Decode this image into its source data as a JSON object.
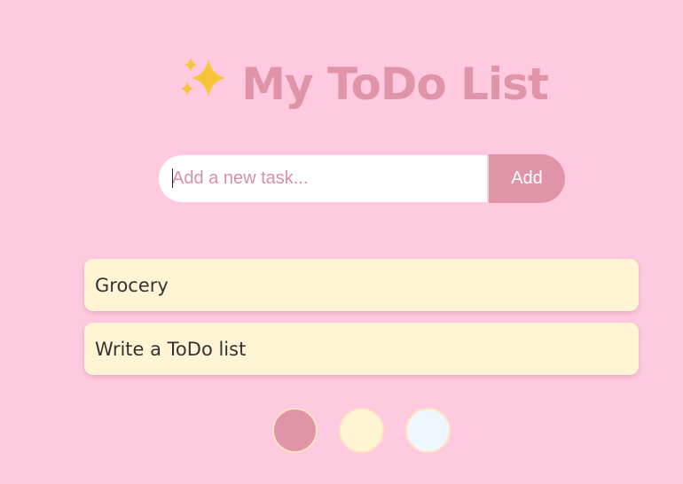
{
  "header": {
    "title": "My ToDo List",
    "icon": "sparkles-icon"
  },
  "add_task": {
    "placeholder": "Add a new task...",
    "value": "",
    "button_label": "Add"
  },
  "tasks": [
    {
      "text": "Grocery"
    },
    {
      "text": "Write a ToDo list"
    }
  ],
  "themes": {
    "colors": [
      "#e094a8",
      "#fff5d5",
      "#eef7ff"
    ],
    "selected_index": 0
  },
  "colors": {
    "background": "#ffcae0",
    "accent": "#e094a8",
    "task_background": "#fff5d5",
    "text": "#333333",
    "sparkle": "#f8c437"
  }
}
